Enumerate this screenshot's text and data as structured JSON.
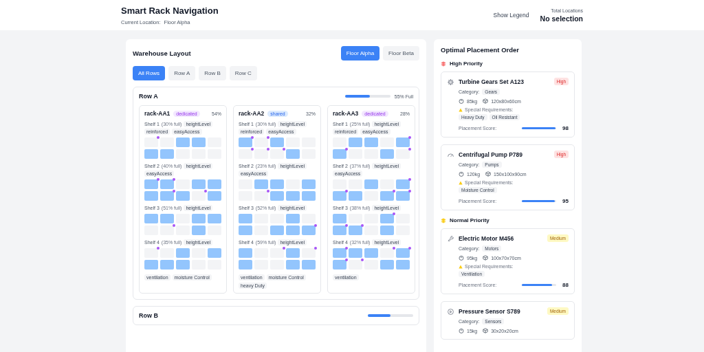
{
  "header": {
    "title": "Smart Rack Navigation",
    "location_label": "Current Location:",
    "location_value": "Floor Alpha",
    "legend_button": "Show Legend",
    "total_label": "Total Locations",
    "total_value": "No selection"
  },
  "layout": {
    "title": "Warehouse Layout",
    "floors": [
      {
        "label": "Floor Alpha",
        "selected": true
      },
      {
        "label": "Floor Beta",
        "selected": false
      }
    ],
    "row_filters": [
      {
        "label": "All Rows",
        "selected": true
      },
      {
        "label": "Row A",
        "selected": false
      },
      {
        "label": "Row B",
        "selected": false
      },
      {
        "label": "Row C",
        "selected": false
      }
    ],
    "rows": [
      {
        "title": "Row A",
        "level": 0.55,
        "fill_text": "55% Full",
        "racks": [
          {
            "name": "rack-AA1",
            "type": "dedicated",
            "percent": "54%",
            "features": [
              "ventilation",
              "moisture Control"
            ],
            "shelves": [
              {
                "label": "Shelf 1",
                "fill": "(30% full)",
                "tags": [
                  "heightLevel",
                  "reinforced",
                  "easyAccess"
                ],
                "slots": [
                  {
                    "filled": false,
                    "marked": true
                  },
                  {
                    "filled": false,
                    "marked": false
                  },
                  {
                    "filled": true,
                    "marked": false
                  },
                  {
                    "filled": true,
                    "marked": false
                  },
                  {
                    "filled": false,
                    "marked": false
                  },
                  {
                    "filled": true,
                    "marked": false
                  },
                  {
                    "filled": true,
                    "marked": false
                  },
                  {
                    "filled": false,
                    "marked": false
                  },
                  {
                    "filled": false,
                    "marked": false
                  },
                  {
                    "filled": false,
                    "marked": false
                  }
                ]
              },
              {
                "label": "Shelf 2",
                "fill": "(40% full)",
                "tags": [
                  "heightLevel",
                  "easyAccess"
                ],
                "slots": [
                  {
                    "filled": true,
                    "marked": true
                  },
                  {
                    "filled": true,
                    "marked": true
                  },
                  {
                    "filled": false,
                    "marked": false
                  },
                  {
                    "filled": true,
                    "marked": false
                  },
                  {
                    "filled": true,
                    "marked": false
                  },
                  {
                    "filled": true,
                    "marked": false
                  },
                  {
                    "filled": true,
                    "marked": true
                  },
                  {
                    "filled": true,
                    "marked": false
                  },
                  {
                    "filled": false,
                    "marked": true
                  },
                  {
                    "filled": true,
                    "marked": false
                  }
                ]
              },
              {
                "label": "Shelf 3",
                "fill": "(51% full)",
                "tags": [
                  "heightLevel"
                ],
                "slots": [
                  {
                    "filled": true,
                    "marked": false
                  },
                  {
                    "filled": true,
                    "marked": false
                  },
                  {
                    "filled": false,
                    "marked": false
                  },
                  {
                    "filled": true,
                    "marked": false
                  },
                  {
                    "filled": true,
                    "marked": false
                  },
                  {
                    "filled": false,
                    "marked": false
                  },
                  {
                    "filled": false,
                    "marked": true
                  },
                  {
                    "filled": false,
                    "marked": false
                  },
                  {
                    "filled": true,
                    "marked": false
                  },
                  {
                    "filled": false,
                    "marked": false
                  }
                ]
              },
              {
                "label": "Shelf 4",
                "fill": "(35% full)",
                "tags": [
                  "heightLevel"
                ],
                "slots": [
                  {
                    "filled": false,
                    "marked": true
                  },
                  {
                    "filled": false,
                    "marked": false
                  },
                  {
                    "filled": true,
                    "marked": false
                  },
                  {
                    "filled": false,
                    "marked": false
                  },
                  {
                    "filled": true,
                    "marked": false
                  },
                  {
                    "filled": true,
                    "marked": false
                  },
                  {
                    "filled": true,
                    "marked": false
                  },
                  {
                    "filled": true,
                    "marked": false
                  },
                  {
                    "filled": false,
                    "marked": false
                  },
                  {
                    "filled": false,
                    "marked": false
                  }
                ]
              }
            ]
          },
          {
            "name": "rack-AA2",
            "type": "shared",
            "percent": "32%",
            "features": [
              "ventilation",
              "moisture Control",
              "heavy Duty"
            ],
            "shelves": [
              {
                "label": "Shelf 1",
                "fill": "(30% full)",
                "tags": [
                  "heightLevel",
                  "reinforced",
                  "easyAccess"
                ],
                "slots": [
                  {
                    "filled": true,
                    "marked": true
                  },
                  {
                    "filled": false,
                    "marked": true
                  },
                  {
                    "filled": true,
                    "marked": false
                  },
                  {
                    "filled": false,
                    "marked": false
                  },
                  {
                    "filled": false,
                    "marked": false
                  },
                  {
                    "filled": false,
                    "marked": true
                  },
                  {
                    "filled": false,
                    "marked": true
                  },
                  {
                    "filled": false,
                    "marked": true
                  },
                  {
                    "filled": true,
                    "marked": false
                  },
                  {
                    "filled": false,
                    "marked": false
                  }
                ]
              },
              {
                "label": "Shelf 2",
                "fill": "(23% full)",
                "tags": [
                  "heightLevel",
                  "easyAccess"
                ],
                "slots": [
                  {
                    "filled": false,
                    "marked": false
                  },
                  {
                    "filled": true,
                    "marked": false
                  },
                  {
                    "filled": true,
                    "marked": false
                  },
                  {
                    "filled": false,
                    "marked": false
                  },
                  {
                    "filled": true,
                    "marked": false
                  },
                  {
                    "filled": false,
                    "marked": false
                  },
                  {
                    "filled": false,
                    "marked": true
                  },
                  {
                    "filled": true,
                    "marked": false
                  },
                  {
                    "filled": true,
                    "marked": false
                  },
                  {
                    "filled": true,
                    "marked": false
                  }
                ]
              },
              {
                "label": "Shelf 3",
                "fill": "(52% full)",
                "tags": [
                  "heightLevel"
                ],
                "slots": [
                  {
                    "filled": true,
                    "marked": false
                  },
                  {
                    "filled": false,
                    "marked": false
                  },
                  {
                    "filled": false,
                    "marked": false
                  },
                  {
                    "filled": true,
                    "marked": false
                  },
                  {
                    "filled": false,
                    "marked": false
                  },
                  {
                    "filled": true,
                    "marked": false
                  },
                  {
                    "filled": false,
                    "marked": false
                  },
                  {
                    "filled": true,
                    "marked": false
                  },
                  {
                    "filled": true,
                    "marked": false
                  },
                  {
                    "filled": true,
                    "marked": true
                  }
                ]
              },
              {
                "label": "Shelf 4",
                "fill": "(59% full)",
                "tags": [
                  "heightLevel"
                ],
                "slots": [
                  {
                    "filled": true,
                    "marked": false
                  },
                  {
                    "filled": false,
                    "marked": false
                  },
                  {
                    "filled": false,
                    "marked": true
                  },
                  {
                    "filled": true,
                    "marked": false
                  },
                  {
                    "filled": false,
                    "marked": true
                  },
                  {
                    "filled": true,
                    "marked": false
                  },
                  {
                    "filled": false,
                    "marked": false
                  },
                  {
                    "filled": false,
                    "marked": false
                  },
                  {
                    "filled": true,
                    "marked": false
                  },
                  {
                    "filled": true,
                    "marked": false
                  }
                ]
              }
            ]
          },
          {
            "name": "rack-AA3",
            "type": "dedicated",
            "percent": "28%",
            "features": [
              "ventilation"
            ],
            "shelves": [
              {
                "label": "Shelf 1",
                "fill": "(25% full)",
                "tags": [
                  "heightLevel",
                  "reinforced",
                  "easyAccess"
                ],
                "slots": [
                  {
                    "filled": false,
                    "marked": false
                  },
                  {
                    "filled": true,
                    "marked": false
                  },
                  {
                    "filled": true,
                    "marked": false
                  },
                  {
                    "filled": false,
                    "marked": false
                  },
                  {
                    "filled": true,
                    "marked": true
                  },
                  {
                    "filled": true,
                    "marked": true
                  },
                  {
                    "filled": false,
                    "marked": false
                  },
                  {
                    "filled": false,
                    "marked": false
                  },
                  {
                    "filled": true,
                    "marked": false
                  },
                  {
                    "filled": false,
                    "marked": true
                  }
                ]
              },
              {
                "label": "Shelf 2",
                "fill": "(37% full)",
                "tags": [
                  "heightLevel",
                  "easyAccess"
                ],
                "slots": [
                  {
                    "filled": false,
                    "marked": false
                  },
                  {
                    "filled": false,
                    "marked": false
                  },
                  {
                    "filled": true,
                    "marked": false
                  },
                  {
                    "filled": false,
                    "marked": false
                  },
                  {
                    "filled": true,
                    "marked": true
                  },
                  {
                    "filled": true,
                    "marked": true
                  },
                  {
                    "filled": true,
                    "marked": false
                  },
                  {
                    "filled": false,
                    "marked": false
                  },
                  {
                    "filled": true,
                    "marked": true
                  },
                  {
                    "filled": true,
                    "marked": true
                  }
                ]
              },
              {
                "label": "Shelf 3",
                "fill": "(38% full)",
                "tags": [
                  "heightLevel"
                ],
                "slots": [
                  {
                    "filled": true,
                    "marked": false
                  },
                  {
                    "filled": false,
                    "marked": false
                  },
                  {
                    "filled": false,
                    "marked": false
                  },
                  {
                    "filled": true,
                    "marked": true
                  },
                  {
                    "filled": false,
                    "marked": false
                  },
                  {
                    "filled": true,
                    "marked": true
                  },
                  {
                    "filled": true,
                    "marked": true
                  },
                  {
                    "filled": false,
                    "marked": false
                  },
                  {
                    "filled": true,
                    "marked": false
                  },
                  {
                    "filled": false,
                    "marked": false
                  }
                ]
              },
              {
                "label": "Shelf 4",
                "fill": "(32% full)",
                "tags": [
                  "heightLevel"
                ],
                "slots": [
                  {
                    "filled": true,
                    "marked": true
                  },
                  {
                    "filled": true,
                    "marked": false
                  },
                  {
                    "filled": true,
                    "marked": false
                  },
                  {
                    "filled": false,
                    "marked": true
                  },
                  {
                    "filled": true,
                    "marked": true
                  },
                  {
                    "filled": true,
                    "marked": true
                  },
                  {
                    "filled": false,
                    "marked": true
                  },
                  {
                    "filled": false,
                    "marked": false
                  },
                  {
                    "filled": true,
                    "marked": false
                  },
                  {
                    "filled": true,
                    "marked": false
                  }
                ]
              }
            ]
          }
        ]
      },
      {
        "title": "Row B",
        "level": 0.5,
        "racks": []
      }
    ]
  },
  "placement": {
    "title": "Optimal Placement Order",
    "groups": [
      {
        "title": "High Priority",
        "kind": "high",
        "items": [
          {
            "name": "Turbine Gears Set A123",
            "priority_label": "High",
            "category_label": "Category:",
            "category": "Gears",
            "weight": "85kg",
            "dims": "120x80x60cm",
            "req_label": "Special Requirements:",
            "requirements": [
              "Heavy Duty",
              "Oil Resistant"
            ],
            "score_label": "Placement Score:",
            "level": 0.98,
            "score": "98"
          },
          {
            "name": "Centrifugal Pump P789",
            "priority_label": "High",
            "category_label": "Category:",
            "category": "Pumps",
            "weight": "120kg",
            "dims": "150x100x90cm",
            "req_label": "Special Requirements:",
            "requirements": [
              "Moisture Control"
            ],
            "score_label": "Placement Score:",
            "level": 0.95,
            "score": "95"
          }
        ]
      },
      {
        "title": "Normal Priority",
        "kind": "normal",
        "items": [
          {
            "name": "Electric Motor M456",
            "priority_label": "Medium",
            "category_label": "Category:",
            "category": "Motors",
            "weight": "95kg",
            "dims": "100x70x70cm",
            "req_label": "Special Requirements:",
            "requirements": [
              "Ventilation"
            ],
            "score_label": "Placement Score:",
            "level": 0.88,
            "score": "88"
          },
          {
            "name": "Pressure Sensor S789",
            "priority_label": "Medium",
            "category_label": "Category:",
            "category": "Sensors",
            "weight": "15kg",
            "dims": "30x20x20cm"
          }
        ]
      }
    ]
  }
}
